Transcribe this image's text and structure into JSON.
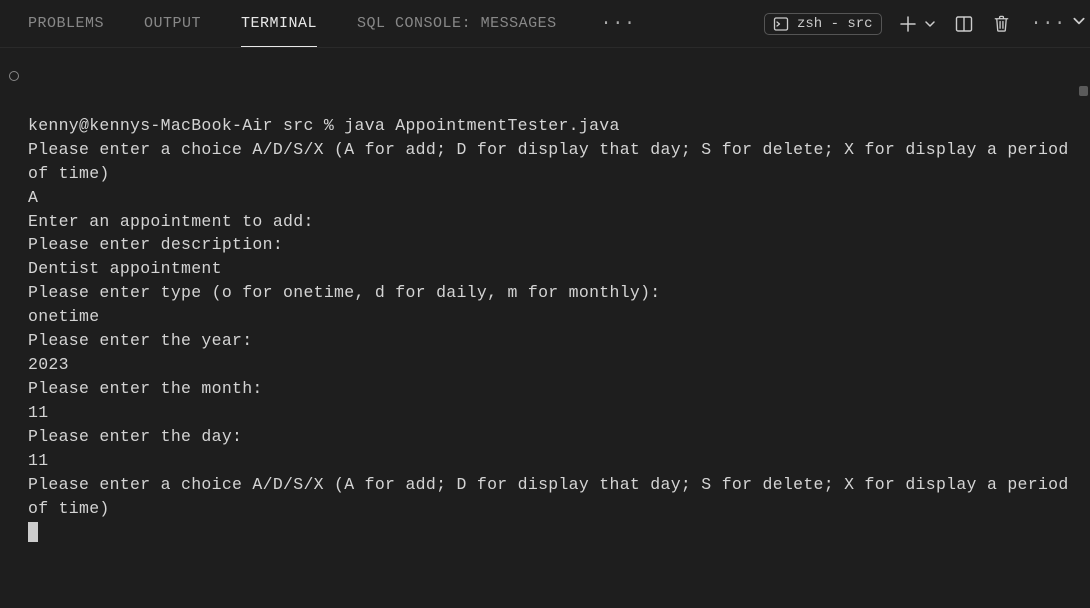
{
  "tabs": {
    "problems": "PROBLEMS",
    "output": "OUTPUT",
    "terminal": "TERMINAL",
    "sql_console": "SQL CONSOLE: MESSAGES"
  },
  "shell": {
    "label": "zsh - src"
  },
  "terminal": {
    "line1": "kenny@kennys-MacBook-Air src % java AppointmentTester.java",
    "line2": "Please enter a choice A/D/S/X (A for add; D for display that day; S for delete; X for display a period of time)",
    "line3": "A",
    "line4": "Enter an appointment to add:",
    "line5": "Please enter description:",
    "line6": "Dentist appointment",
    "line7": "Please enter type (o for onetime, d for daily, m for monthly):",
    "line8": "onetime",
    "line9": "Please enter the year:",
    "line10": "2023",
    "line11": "Please enter the month:",
    "line12": "11",
    "line13": "Please enter the day:",
    "line14": "11",
    "line15": "Please enter a choice A/D/S/X (A for add; D for display that day; S for delete; X for display a period of time)"
  }
}
